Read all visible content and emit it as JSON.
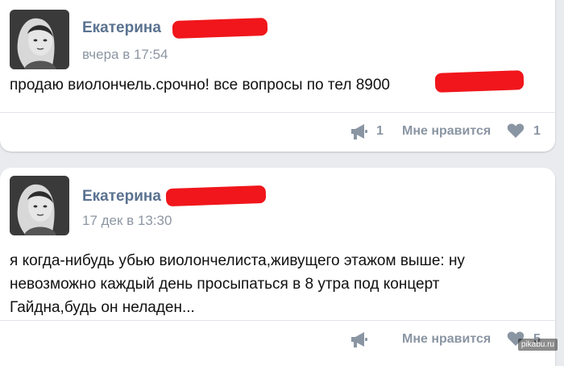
{
  "posts": [
    {
      "author": "Екатерина",
      "time": "вчера в 17:54",
      "text_lines": [
        "продаю виолончель.срочно! все вопросы по тел 8900"
      ],
      "share_count": "1",
      "like_label": "Мне нравится",
      "like_count": "1"
    },
    {
      "author": "Екатерина",
      "time": "17 дек в 13:30",
      "text_lines": [
        "я когда-нибудь убью виолончелиста,живущего этажом выше: ну",
        "невозможно каждый день просыпаться в 8 утра под концерт",
        "Гайдна,будь он неладен..."
      ],
      "share_count": "",
      "like_label": "Мне нравится",
      "like_count": "5"
    }
  ],
  "watermark": "pikabu.ru",
  "colors": {
    "author": "#5a7290",
    "meta": "#8c96a3",
    "action": "#8a95a3",
    "redaction": "#f0161b",
    "background": "#e9ebee"
  },
  "icons": {
    "share": "megaphone-icon",
    "like": "heart-icon",
    "avatar": "user-photo-avatar"
  }
}
